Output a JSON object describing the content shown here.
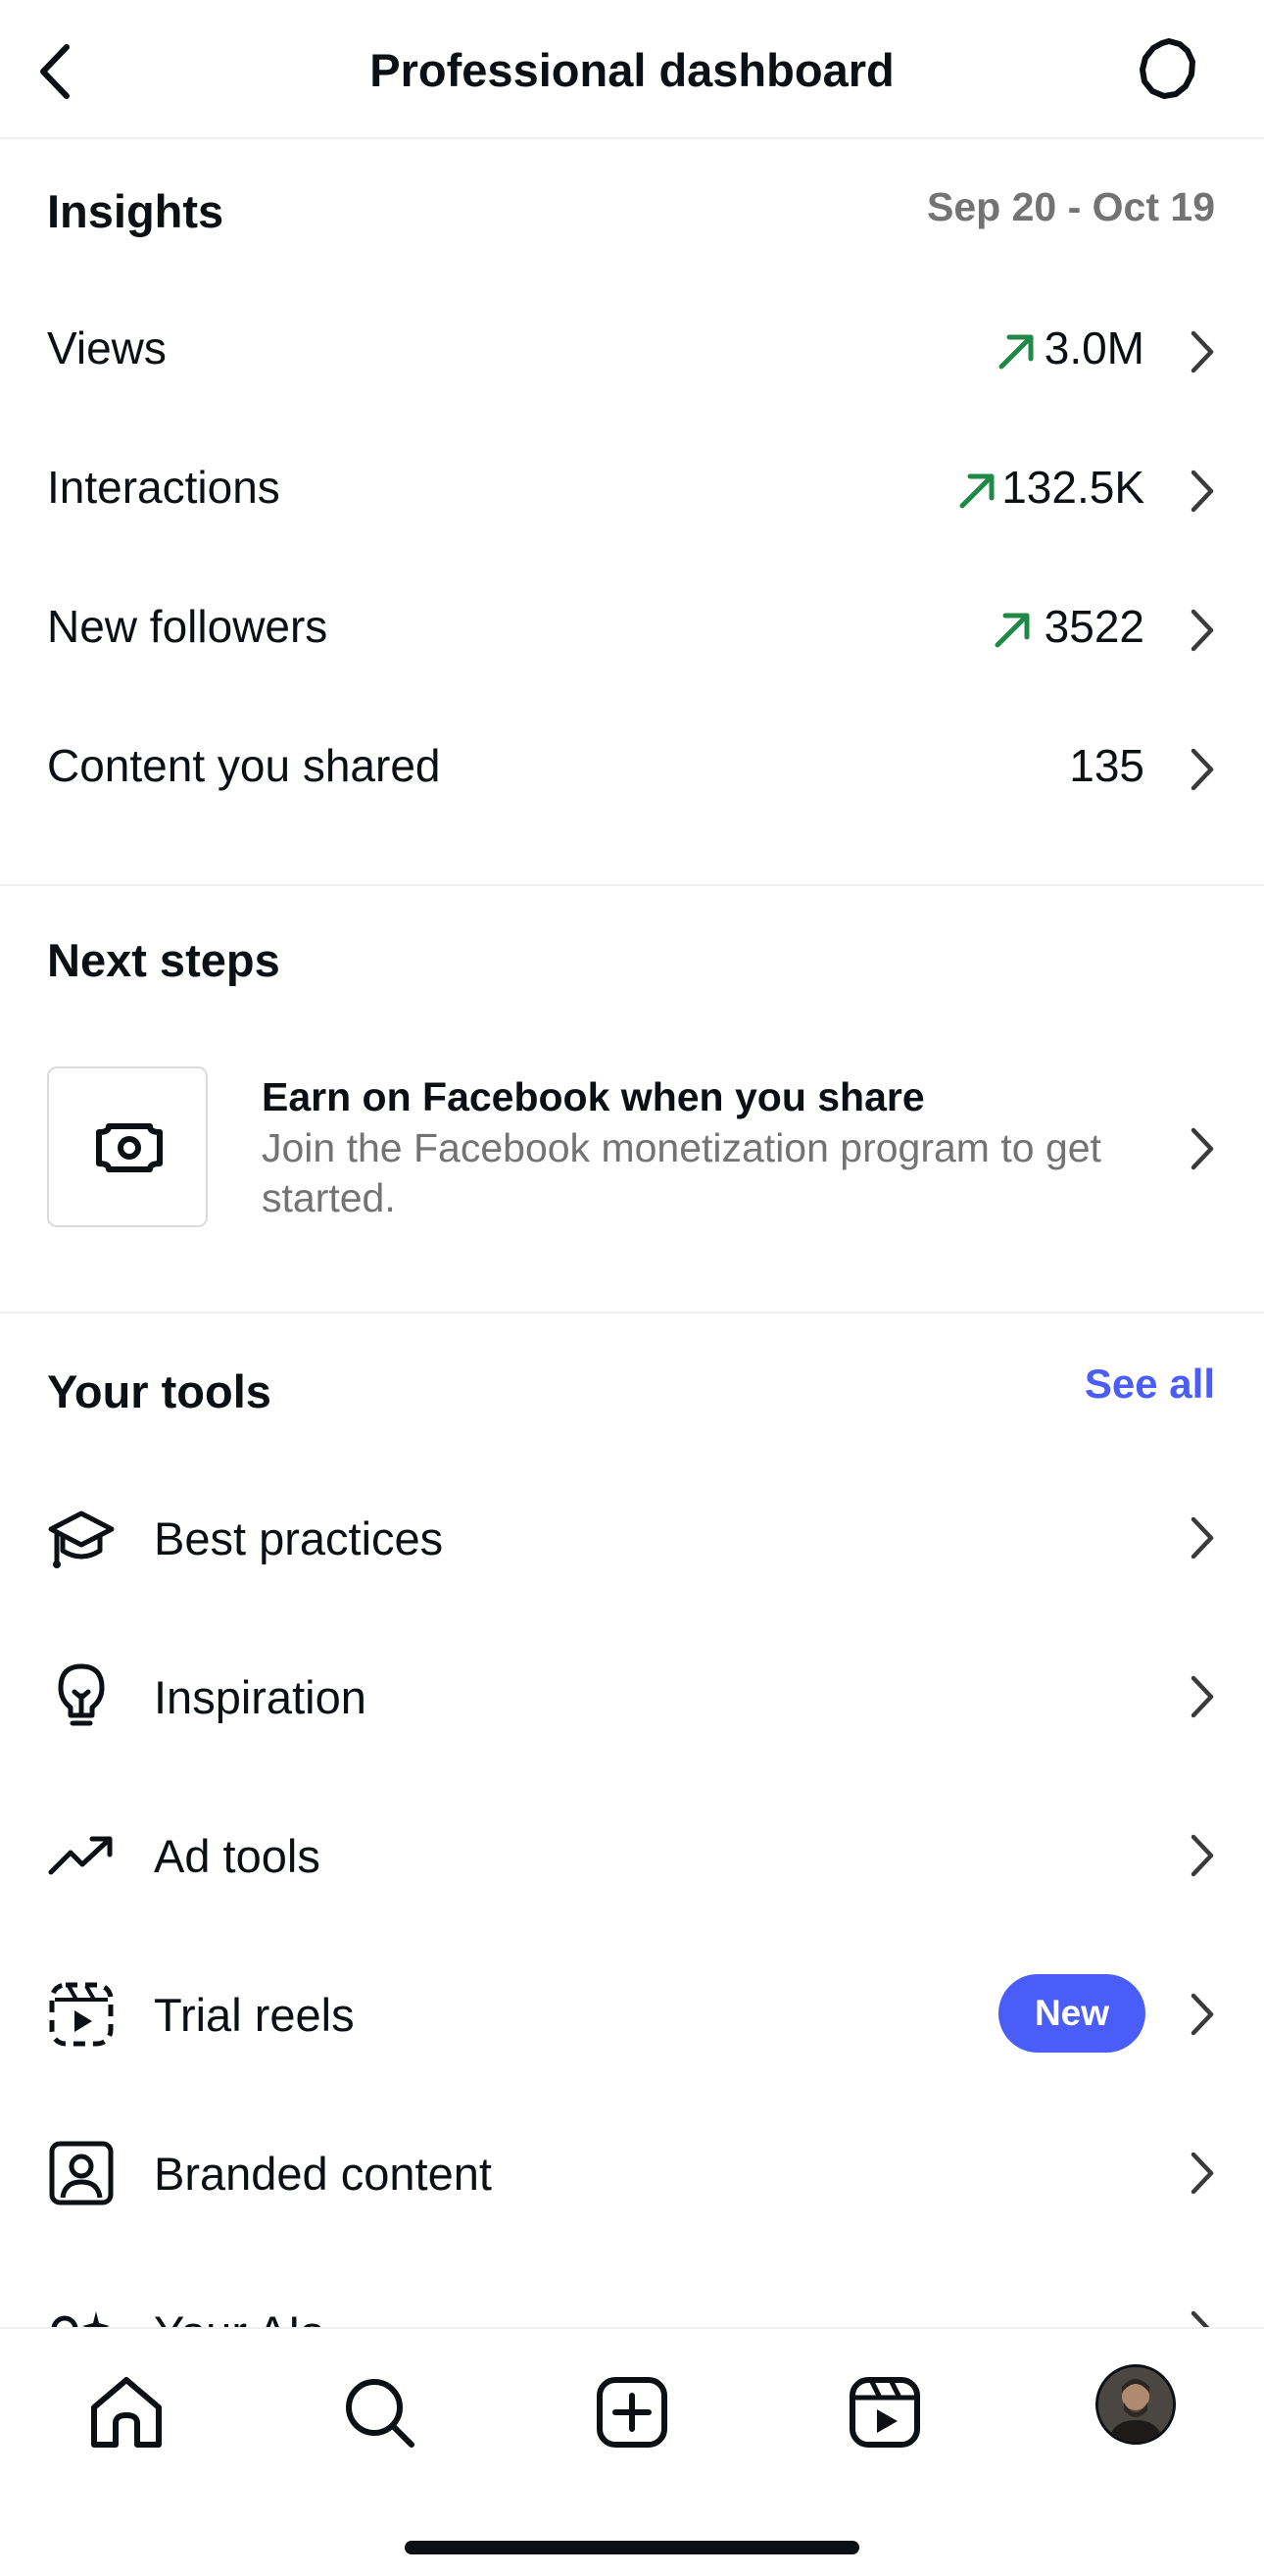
{
  "header": {
    "title": "Professional dashboard",
    "back_icon": "chevron-left-icon",
    "settings_icon": "gear-icon"
  },
  "insights": {
    "title": "Insights",
    "date_range": "Sep 20 - Oct 19",
    "trend_color": "#1e8a45",
    "rows": [
      {
        "label": "Views",
        "value": "3.0M",
        "trend": "up"
      },
      {
        "label": "Interactions",
        "value": "132.5K",
        "trend": "up"
      },
      {
        "label": "New followers",
        "value": "3522",
        "trend": "up"
      },
      {
        "label": "Content you shared",
        "value": "135",
        "trend": "none"
      }
    ]
  },
  "next_steps": {
    "title": "Next steps",
    "item": {
      "icon": "money-icon",
      "title": "Earn on Facebook when you share",
      "description": "Join the Facebook monetization program to get started."
    }
  },
  "tools": {
    "title": "Your tools",
    "see_all": "See all",
    "accent": "#4a5df9",
    "items": [
      {
        "label": "Best practices",
        "icon": "graduation-cap-icon"
      },
      {
        "label": "Inspiration",
        "icon": "lightbulb-icon"
      },
      {
        "label": "Ad tools",
        "icon": "trending-up-icon"
      },
      {
        "label": "Trial reels",
        "icon": "trial-reels-icon",
        "badge": "New"
      },
      {
        "label": "Branded content",
        "icon": "branded-content-icon"
      },
      {
        "label": "Your AIs",
        "icon": "ai-sparkle-icon"
      }
    ]
  },
  "bottom_nav": {
    "items": [
      "home-icon",
      "search-icon",
      "create-icon",
      "reels-icon",
      "profile-avatar"
    ]
  }
}
